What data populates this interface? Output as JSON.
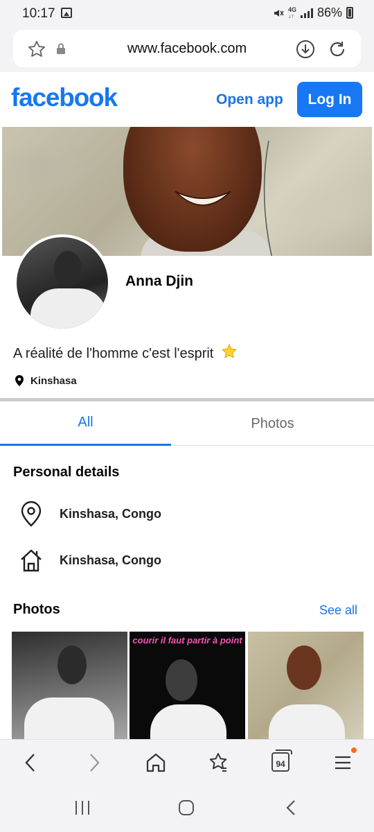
{
  "status_bar": {
    "time": "10:17",
    "net_label_top": "4G",
    "battery": "86%"
  },
  "browser": {
    "url": "www.facebook.com",
    "tab_count": "94"
  },
  "fb_header": {
    "logo": "facebook",
    "open_app": "Open app",
    "login": "Log In"
  },
  "profile": {
    "name": "Anna Djin",
    "bio": "A réalité de l'homme c'est l'esprit",
    "location": "Kinshasa"
  },
  "tabs": [
    {
      "label": "All",
      "active": true
    },
    {
      "label": "Photos",
      "active": false
    }
  ],
  "personal_details": {
    "title": "Personal details",
    "items": [
      {
        "icon": "location-pin-icon",
        "text": "Kinshasa, Congo"
      },
      {
        "icon": "home-icon",
        "text": "Kinshasa, Congo"
      }
    ]
  },
  "photos": {
    "title": "Photos",
    "see_all": "See all",
    "items": [
      {
        "caption": ""
      },
      {
        "caption": "courir il faut partir à point"
      },
      {
        "caption": ""
      }
    ]
  },
  "colors": {
    "brand": "#1877f2",
    "link": "#1b74e4",
    "notification_dot": "#ff6a1a"
  }
}
